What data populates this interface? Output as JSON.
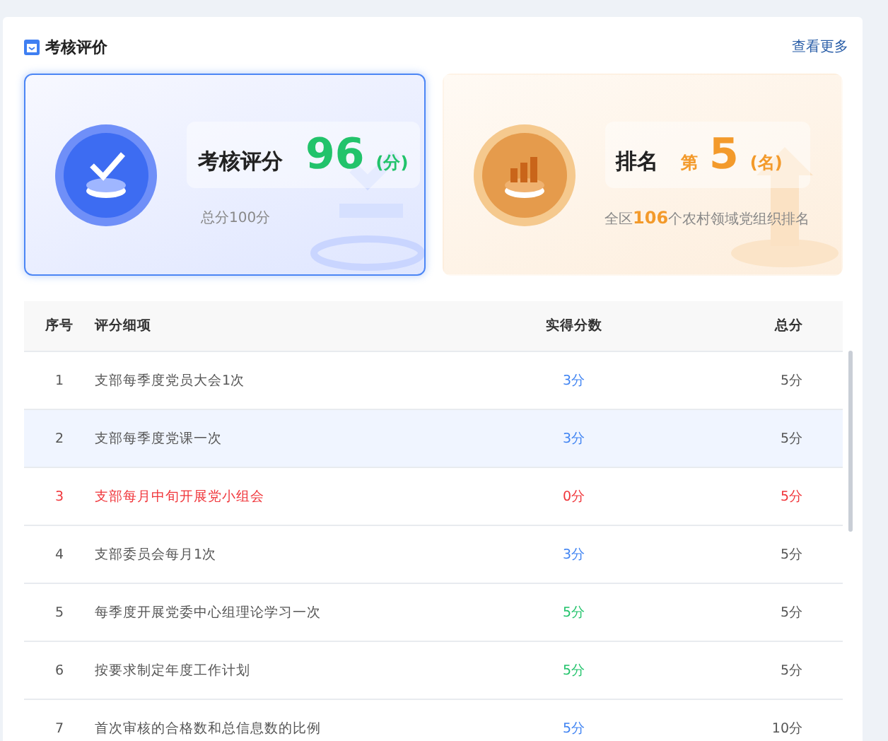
{
  "section": {
    "title": "考核评价",
    "more_link": "查看更多"
  },
  "score_card": {
    "label": "考核评分",
    "value": "96",
    "unit": "(分)",
    "note": "总分100分",
    "selected": true
  },
  "rank_card": {
    "label": "排名",
    "prefix": "第",
    "value": "5",
    "unit": "(名)",
    "note": "全区**106**个农村领域党组织排名",
    "selected": false
  },
  "table": {
    "columns": [
      "序号",
      "评分细项",
      "实得分数",
      "总分"
    ],
    "rows": [
      {
        "index": "1",
        "item": "支部每季度党员大会1次",
        "score": "3分",
        "total": "5分",
        "kind": "partial",
        "selected": false
      },
      {
        "index": "2",
        "item": "支部每季度党课一次",
        "score": "3分",
        "total": "5分",
        "kind": "partial",
        "selected": true
      },
      {
        "index": "3",
        "item": "支部每月中旬开展党小组会",
        "score": "0分",
        "total": "5分",
        "kind": "failed",
        "selected": false
      },
      {
        "index": "4",
        "item": "支部委员会每月1次",
        "score": "3分",
        "total": "5分",
        "kind": "partial",
        "selected": false
      },
      {
        "index": "5",
        "item": "每季度开展党委中心组理论学习一次",
        "score": "5分",
        "total": "5分",
        "kind": "full",
        "selected": false
      },
      {
        "index": "6",
        "item": "按要求制定年度工作计划",
        "score": "5分",
        "total": "5分",
        "kind": "full",
        "selected": false
      },
      {
        "index": "7",
        "item": "首次审核的合格数和总信息数的比例",
        "score": "5分",
        "total": "10分",
        "kind": "partial",
        "selected": false
      }
    ]
  }
}
